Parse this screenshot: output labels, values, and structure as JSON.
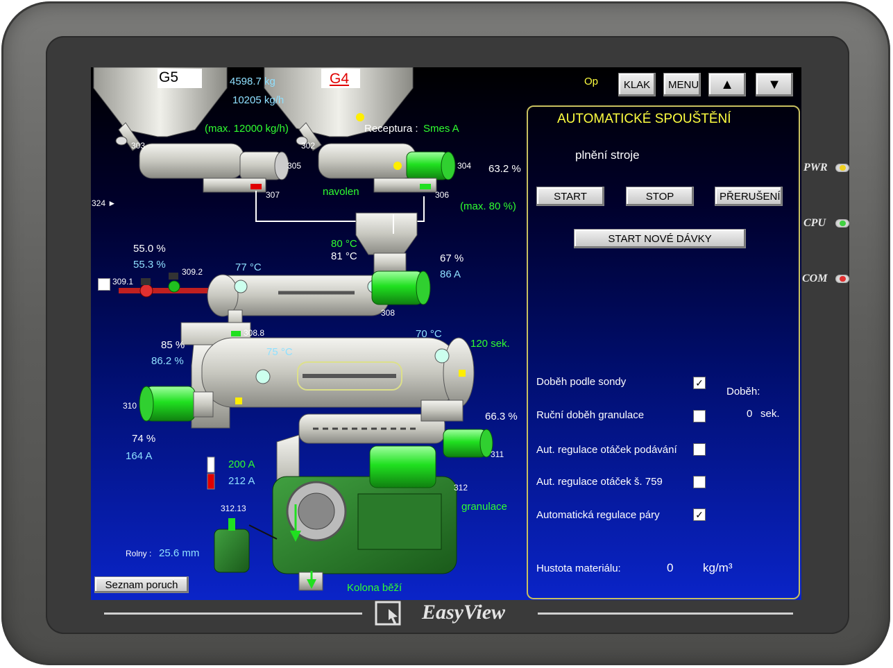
{
  "device": {
    "brand": "EasyView",
    "leds": [
      {
        "label": "PWR",
        "color": "#f0d020"
      },
      {
        "label": "CPU",
        "color": "#40d040"
      },
      {
        "label": "COM",
        "color": "#e03030"
      }
    ]
  },
  "header": {
    "op_label": "Op",
    "buttons": [
      "KLAK",
      "MENU"
    ],
    "up_arrow": "▲",
    "down_arrow": "▼"
  },
  "silos": {
    "g5_label": "G5",
    "g4_label": "G4",
    "weight": "4598.7 kg",
    "flow": "10205 kg/h",
    "max_flow": "(max. 12000 kg/h)",
    "recipe_label": "Receptura :",
    "recipe_value": "Smes A",
    "selected": "navolen",
    "feeder_percent": "63.2 %",
    "feeder_max": "(max.  80 %)"
  },
  "tags": {
    "t303": "303",
    "t302": "302",
    "t305": "305",
    "t304": "304",
    "t307": "307",
    "t306": "306",
    "t324": "324 ►",
    "t309_1": "309.1",
    "t309_2": "309.2",
    "t308": "308",
    "t308_8": "308.8",
    "t310": "310",
    "t311": "311",
    "t312": "312",
    "t312_13": "312.13"
  },
  "conditioner1": {
    "pct1": "55.0 %",
    "pct2": "55.3 %",
    "temp_set": "80 °C",
    "temp_act": "81 °C",
    "temp_body": "77 °C",
    "motor_pct": "67 %",
    "motor_amp": "86 A"
  },
  "conditioner2": {
    "pct1": "85 %",
    "pct2": "86.2 %",
    "temp_body": "75 °C",
    "temp_end": "70 °C",
    "time": "120 sek.",
    "motor_pct": "74 %",
    "motor_amp": "164 A",
    "feeder_pct": "66.3 %"
  },
  "press": {
    "amp_set": "200 A",
    "amp_act": "212 A",
    "label": "granulace",
    "rolls_label": "Rolny :",
    "rolls_value": "25.6 mm",
    "status": "Kolona běží"
  },
  "fault_button": "Seznam poruch",
  "panel": {
    "title": "AUTOMATICKÉ SPOUŠTĚNÍ",
    "state": "plnění stroje",
    "start": "START",
    "stop": "STOP",
    "interrupt": "PŘERUŠENÍ",
    "new_batch": "START NOVÉ DÁVKY",
    "options": [
      {
        "label": "Doběh podle sondy",
        "checked": true
      },
      {
        "label": "Ruční doběh granulace",
        "checked": false
      },
      {
        "label": "Aut. regulace otáček podávání",
        "checked": false
      },
      {
        "label": "Aut. regulace otáček š. 759",
        "checked": false
      },
      {
        "label": "Automatická regulace páry",
        "checked": true
      }
    ],
    "run_label": "Doběh:",
    "run_value": "0",
    "run_unit": "sek.",
    "density_label": "Hustota materiálu:",
    "density_value": "0",
    "density_unit": "kg/m³"
  }
}
